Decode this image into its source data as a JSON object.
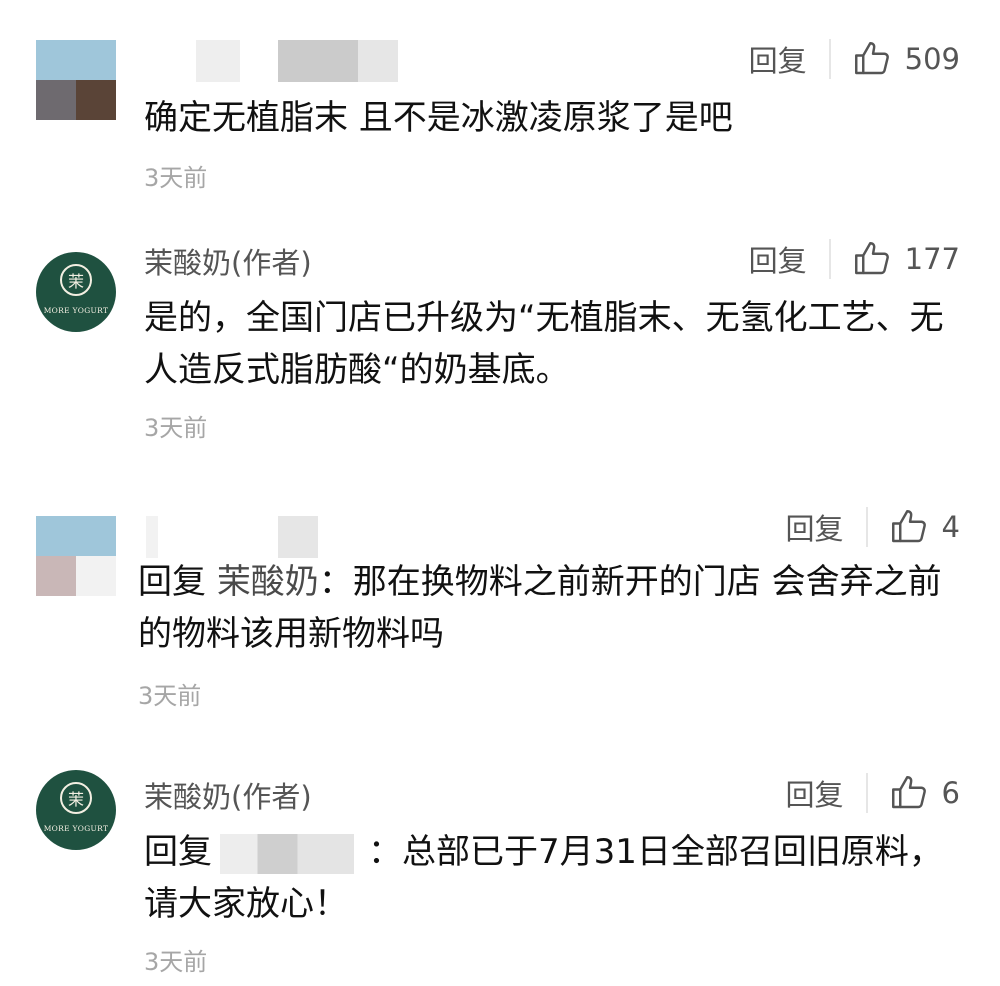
{
  "labels": {
    "reply": "回复",
    "time": "3天前",
    "brand_avatar_text": "MORE YOGURT",
    "brand_avatar_mark": "茉"
  },
  "comments": [
    {
      "author": "",
      "author_masked": true,
      "likes": "509",
      "text": "确定无植脂末 且不是冰激凌原浆了是吧"
    },
    {
      "author": "茉酸奶(作者)",
      "likes": "177",
      "text": "是的，全国门店已升级为“无植脂末、无氢化工艺、无人造反式脂肪酸“的奶基底。"
    },
    {
      "author": "",
      "author_masked": true,
      "likes": "4",
      "reply_prefix": "回复",
      "reply_to": "茉酸奶",
      "text": "：那在换物料之前新开的门店 会舍弃之前的物料该用新物料吗"
    },
    {
      "author": "茉酸奶(作者)",
      "likes": "6",
      "reply_prefix": "回复",
      "text": "：总部已于7月31日全部召回旧原料，请大家放心！"
    }
  ],
  "colors": {
    "brand_green": "#1f5140",
    "meta_gray": "#555555",
    "time_gray": "#a6a6a6"
  }
}
